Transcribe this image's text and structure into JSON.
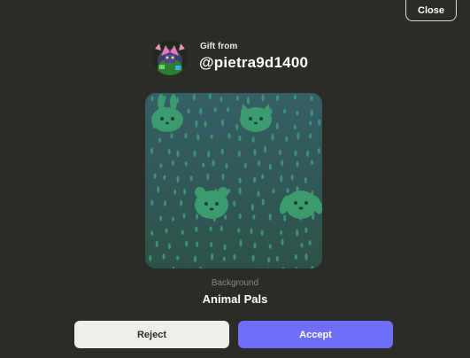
{
  "header": {
    "close_label": "Close"
  },
  "gift": {
    "from_label": "Gift from",
    "username": "@pietra9d1400"
  },
  "item": {
    "type": "Background",
    "name": "Animal Pals"
  },
  "actions": {
    "reject_label": "Reject",
    "accept_label": "Accept"
  },
  "colors": {
    "background": "#2b2b27",
    "accent": "#6e6ef6",
    "preview_bg": "#2f5651",
    "animal_color": "#3b9a6e"
  }
}
